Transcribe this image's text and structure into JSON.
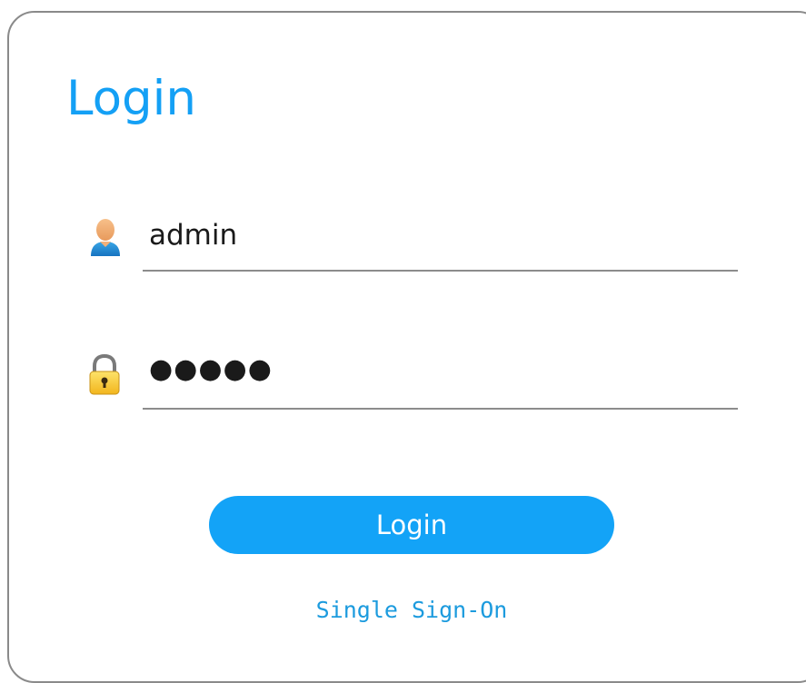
{
  "login_panel": {
    "title": "Login",
    "username": {
      "icon": "user-icon",
      "value": "admin"
    },
    "password": {
      "icon": "lock-icon",
      "masked_value": "●●●●●"
    },
    "login_button_label": "Login",
    "sso_link_label": "Single Sign-On"
  },
  "colors": {
    "accent": "#14a0f5",
    "button": "#13a3f7",
    "link": "#1c9bde",
    "border": "#8a8a8a"
  }
}
